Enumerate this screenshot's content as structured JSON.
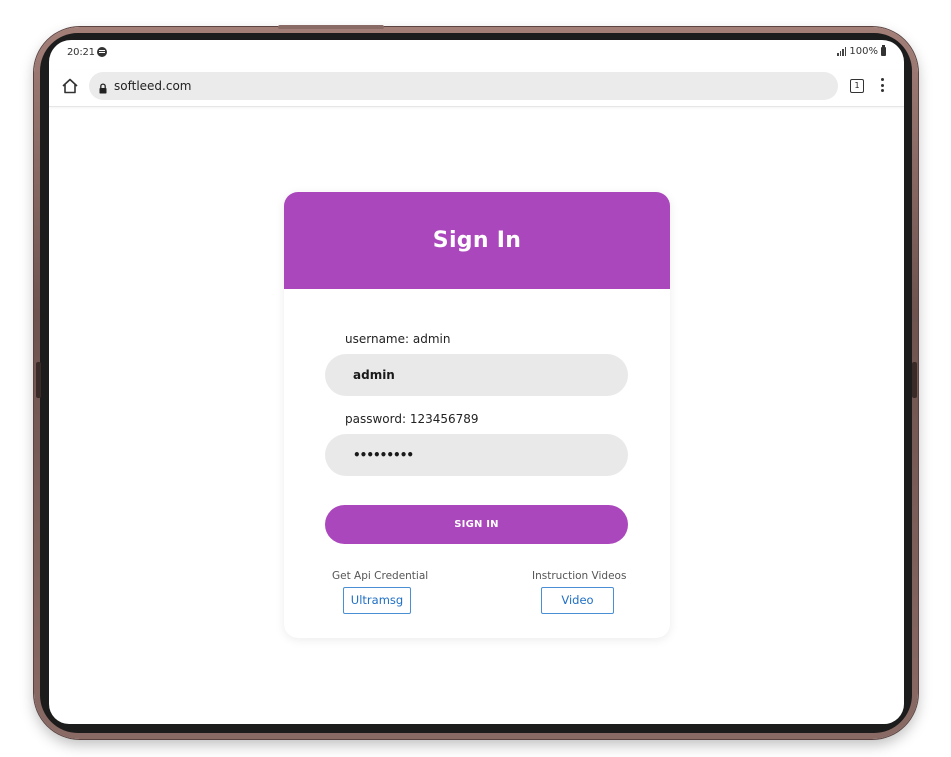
{
  "status_bar": {
    "time": "20:21",
    "app_icon": "spotify-icon",
    "signal_icon": "signal-icon",
    "battery": "100%",
    "battery_icon": "battery-icon"
  },
  "browser": {
    "home_icon": "home-icon",
    "lock_icon": "lock-icon",
    "url": "softleed.com",
    "tab_count": "1",
    "menu_icon": "more-vert-icon"
  },
  "login": {
    "title": "Sign In",
    "username_label": "username: admin",
    "username_value": "admin",
    "password_label": "password: 123456789",
    "password_masked": "•••••••••",
    "signin_button": "SIGN IN",
    "api_label": "Get Api Credential",
    "api_button": "Ultramsg",
    "video_label": "Instruction Videos",
    "video_button": "Video"
  },
  "colors": {
    "accent": "#ab47bc",
    "link": "#1f6fc4",
    "input_bg": "#e9e9e9"
  }
}
